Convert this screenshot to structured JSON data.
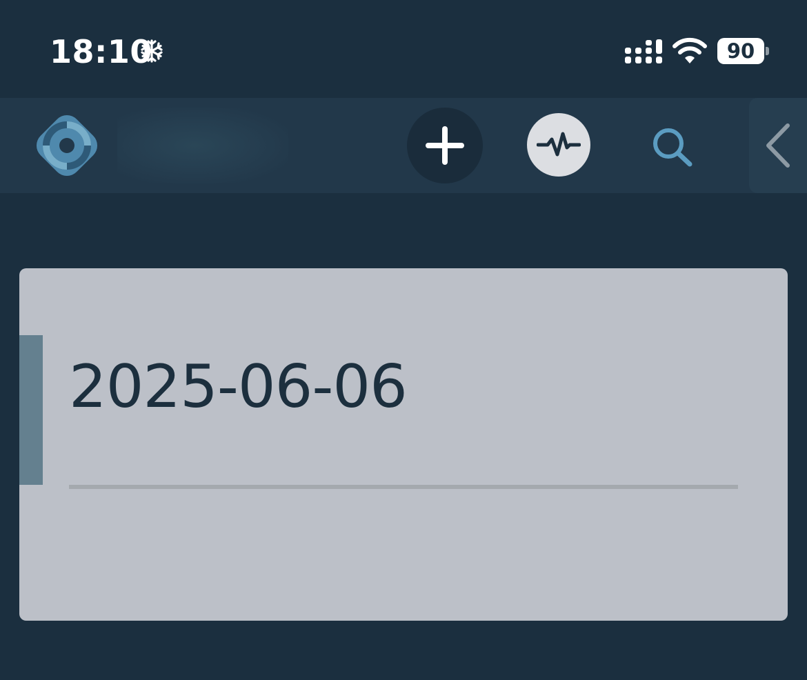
{
  "status_bar": {
    "time": "18:10",
    "focus_icon": "snowflake-icon",
    "signal_icon": "cellular-signal-icon",
    "wifi_icon": "wifi-icon",
    "battery_level": "90"
  },
  "toolbar": {
    "logo_icon": "app-logo",
    "title": "",
    "add_icon": "plus-icon",
    "activity_icon": "activity-pulse-icon",
    "search_icon": "search-icon",
    "collapse_icon": "chevron-left-icon"
  },
  "card": {
    "date": "2025-06-06"
  },
  "colors": {
    "background": "#1b2f3f",
    "toolbar": "#22384a",
    "card": "#bcc0c8",
    "accent": "#64808f",
    "logo": "#4f89ad"
  }
}
